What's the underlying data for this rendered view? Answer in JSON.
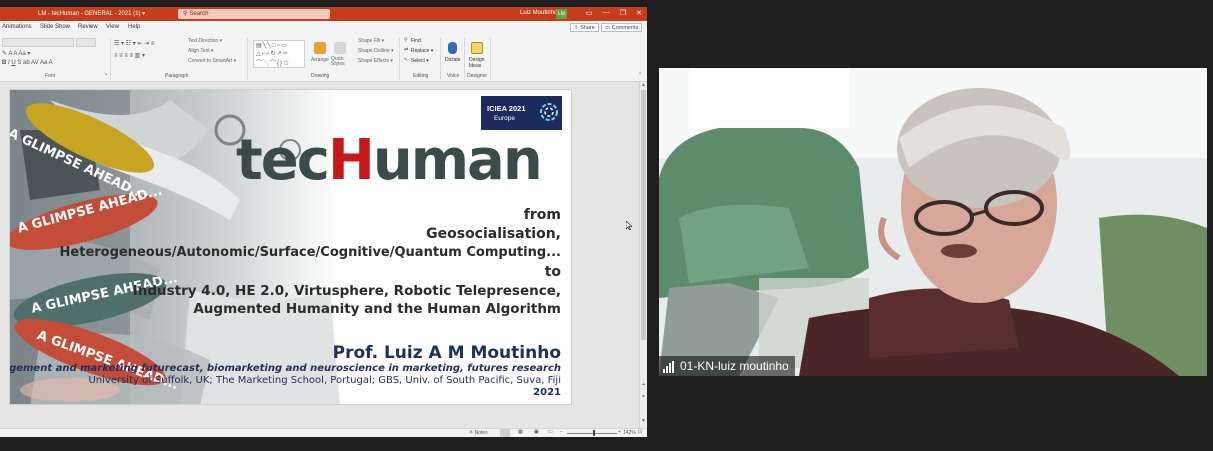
{
  "window": {
    "title": "LM - tecHuman - GENERAL - 2021 (1)  ▾",
    "search_placeholder": "Search",
    "user_name": "Luiz Moutinho",
    "user_initials": "LM",
    "minimize": "—",
    "restore": "❐",
    "close": "✕"
  },
  "menu": {
    "tabs": [
      "Animations",
      "Slide Show",
      "Review",
      "View",
      "Help"
    ],
    "share": "Share",
    "comments": "Comments"
  },
  "ribbon": {
    "groups": [
      "Font",
      "Paragraph",
      "Drawing",
      "Editing",
      "Voice",
      "Designer"
    ],
    "paragraph_items": [
      "Text Direction ▾",
      "Align Text ▾",
      "Convert to SmartArt ▾"
    ],
    "drawing_items": [
      "Shape Fill ▾",
      "Shape Outline ▾",
      "Shape Effects ▾"
    ],
    "arrange": "Arrange",
    "quick_styles": "Quick Styles",
    "editing_items": [
      "Find",
      "Replace ▾",
      "Select ▾"
    ],
    "dictate": "Dictate",
    "design_ideas": "Design Ideas"
  },
  "slide": {
    "glimpse": [
      "A GLIMPSE AHEAD...",
      "A GLIMPSE AHEAD...",
      "A GLIMPSE AHEAD...",
      "A GLIMPSE AHEAD..."
    ],
    "logo_line1": "ICIEA 2021",
    "logo_line2": "Europe",
    "brand_pre": "tec",
    "brand_h": "H",
    "brand_post": "uman",
    "lines": [
      "from",
      "Geosocialisation,",
      "Heterogeneous/Autonomic/Surface/Cognitive/Quantum Computing...",
      "to",
      "Industry 4.0, HE 2.0, Virtusphere, Robotic Telepresence,",
      "Augmented Humanity and  the Human Algorithm"
    ],
    "author": "Prof. Luiz A M Moutinho",
    "tagline": "management and marketing futurecast, biomarketing and neuroscience in marketing, futures research",
    "affiliation": "University of Suffolk, UK; The Marketing School, Portugal; GBS, Univ. of South Pacific, Suva, Fiji",
    "year": "2021"
  },
  "status": {
    "notes": "Notes",
    "zoom": "142%"
  },
  "video": {
    "participant": "01-KN-luiz moutinho"
  }
}
